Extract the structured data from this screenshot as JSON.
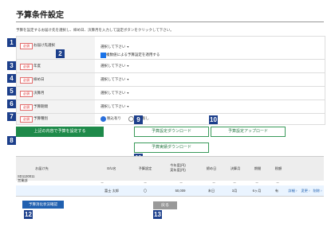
{
  "page": {
    "title": "予算条件設定",
    "description": "予算を設定するお届け先を選択し、締め日、決算月を入力して設定ボタンをクリックして下さい。"
  },
  "badges": [
    "1",
    "2",
    "3",
    "4",
    "5",
    "6",
    "7",
    "8",
    "9",
    "10",
    "11",
    "12",
    "13"
  ],
  "form": {
    "required_tag": "必須",
    "rows": [
      {
        "label": "お届け先選択",
        "value": "選択して下さい",
        "option_label": "複数値による予算設定を適用する"
      },
      {
        "label": "年度",
        "value": "選択して下さい"
      },
      {
        "label": "締め日",
        "value": "選択して下さい"
      },
      {
        "label": "決算月",
        "value": "選択して下さい"
      },
      {
        "label": "予算期間",
        "value": "選択して下さい"
      },
      {
        "label": "予算種別",
        "radio_on": "税込有り",
        "radio_off": "税抜有し"
      }
    ]
  },
  "buttons": {
    "set_budget": "上記の内容で予算を設定する",
    "budget_download": "予算設定ダウンロード",
    "budget_upload": "予算設定アップロード",
    "actual_download": "予算実績ダウンロード",
    "edit_summary": "予算消化状況確認",
    "back": "戻る"
  },
  "table": {
    "headers": [
      "お届け先",
      "E/U名",
      "予算設定",
      "今年度(円)\n実年度(円)",
      "締め日",
      "決算月",
      "期間",
      "税額"
    ],
    "group_row": {
      "name": "SD1130011\n営業部",
      "dash": "－"
    },
    "data_row": {
      "name": "富士 太郎",
      "set": "〇",
      "amount": "50,009",
      "close": "末日",
      "month": "3月",
      "period": "6ヶ月",
      "tax": "有",
      "detail": "詳細 ›",
      "change": "変更 ›",
      "delete": "削除 ›"
    }
  }
}
